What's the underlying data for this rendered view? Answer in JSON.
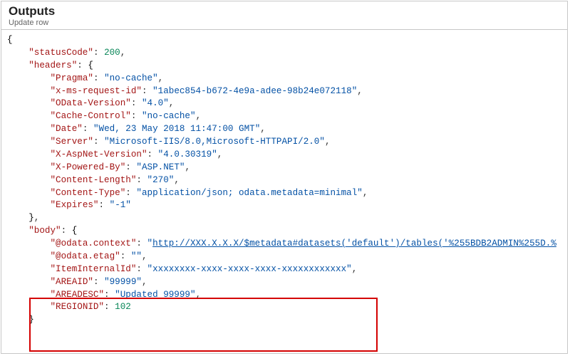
{
  "header": {
    "title": "Outputs",
    "subtitle": "Update row"
  },
  "json": {
    "statusCode": 200,
    "headers": {
      "Pragma": "no-cache",
      "x-ms-request-id": "1abec854-b672-4e9a-adee-98b24e072118",
      "OData-Version": "4.0",
      "Cache-Control": "no-cache",
      "Date": "Wed, 23 May 2018 11:47:00 GMT",
      "Server": "Microsoft-IIS/8.0,Microsoft-HTTPAPI/2.0",
      "X-AspNet-Version": "4.0.30319",
      "X-Powered-By": "ASP.NET",
      "Content-Length": "270",
      "Content-Type": "application/json; odata.metadata=minimal",
      "Expires": "-1"
    },
    "body": {
      "odata_context": "http://XXX.X.X.X/$metadata#datasets('default')/tables('%255BDB2ADMIN%255D.%",
      "odata_etag": "",
      "ItemInternalId": "xxxxxxxx-xxxx-xxxx-xxxx-xxxxxxxxxxxx",
      "AREAID": "99999",
      "AREADESC": "Updated 99999",
      "REGIONID": 102
    }
  }
}
